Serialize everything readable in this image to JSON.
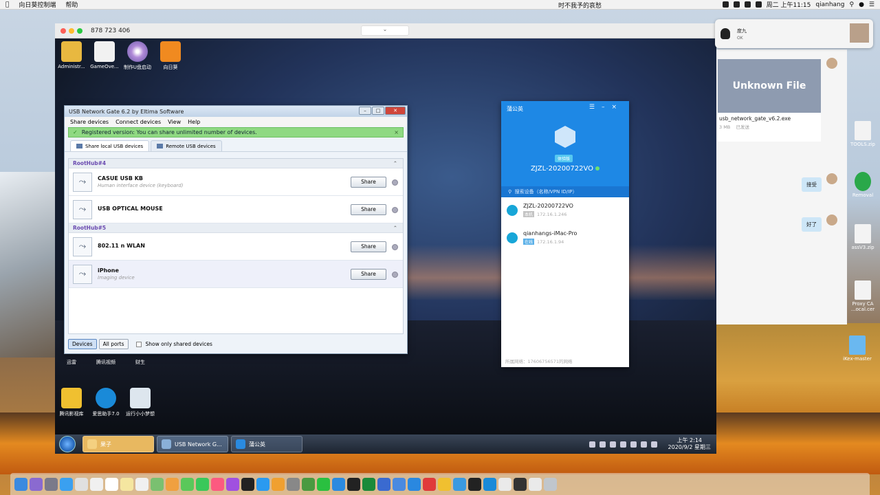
{
  "menubar": {
    "app": "向日葵控制端",
    "help": "帮助",
    "song": "时不我予的哀愁",
    "time": "周二 上午11:15",
    "user": "qianhang"
  },
  "remote": {
    "id": "878 723 406",
    "desktop_icons": [
      {
        "label": "Administr..."
      },
      {
        "label": "GameOve..."
      },
      {
        "label": "制作U盘启动"
      },
      {
        "label": "向日葵"
      },
      {
        "label": "迅雷"
      },
      {
        "label": "腾讯视频"
      },
      {
        "label": "财生"
      },
      {
        "label": "腾讯影视库"
      },
      {
        "label": "爱思助手7.0"
      },
      {
        "label": "运行小小梦想"
      }
    ],
    "taskbar": {
      "items": [
        {
          "label": "果子"
        },
        {
          "label": "USB Network G..."
        },
        {
          "label": "蒲公英"
        }
      ],
      "time": "上午 2:14",
      "date": "2020/9/2 星期三"
    }
  },
  "usb": {
    "title": "USB Network Gate 6.2 by Eltima Software",
    "menu": [
      "Share devices",
      "Connect devices",
      "View",
      "Help"
    ],
    "banner": "Registered version: You can share unlimited number of devices.",
    "tabs": [
      "Share local USB devices",
      "Remote USB devices"
    ],
    "hubs": [
      {
        "name": "RootHub#4",
        "devices": [
          {
            "name": "CASUE USB KB",
            "sub": "Human interface device (keyboard)",
            "btn": "Share"
          },
          {
            "name": "USB OPTICAL MOUSE",
            "sub": "",
            "btn": "Share"
          }
        ]
      },
      {
        "name": "RootHub#5",
        "devices": [
          {
            "name": "802.11 n WLAN",
            "sub": "",
            "btn": "Share"
          },
          {
            "name": "iPhone",
            "sub": "Imaging device",
            "btn": "Share"
          }
        ]
      }
    ],
    "footer": {
      "devices": "Devices",
      "all_ports": "All ports",
      "only_shared": "Show only shared devices"
    }
  },
  "vpn": {
    "title": "蒲公英",
    "badge": "体验版",
    "device_name": "ZJZL-20200722VO",
    "search_placeholder": "搜索设备（名称/VPN ID/IP）",
    "peers": [
      {
        "name": "ZJZL-20200722VO",
        "tag": "本机",
        "ip": "172.16.1.246"
      },
      {
        "name": "qianhangs-iMac-Pro",
        "tag": "在线",
        "ip": "172.16.1.94"
      }
    ],
    "footer": "所属网络：17606756571的网络"
  },
  "chat": {
    "notif_title": "度九",
    "notif_sub": "OK",
    "file_preview": "Unknown File",
    "file_name": "usb_network_gate_v6.2.exe",
    "file_size": "3 MB",
    "file_status": "已发送",
    "bubbles": [
      "接受",
      "好了"
    ]
  },
  "mac_right_icons": [
    {
      "label": "TOOLS.zip"
    },
    {
      "label": "Removal"
    },
    {
      "label": "assV3.zip"
    },
    {
      "label": "Proxy CA ...ocal.cer"
    },
    {
      "label": "iKex-master"
    }
  ]
}
